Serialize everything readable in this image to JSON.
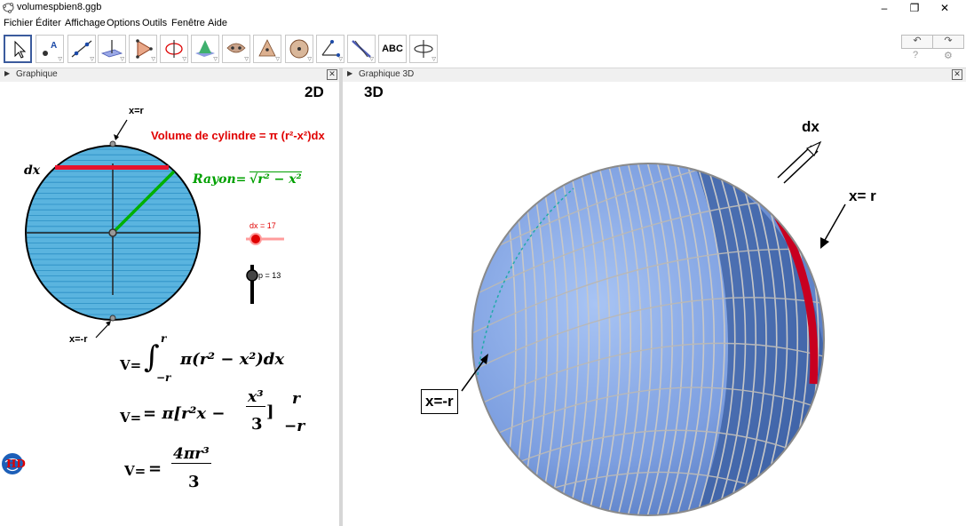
{
  "window": {
    "title": "volumespbien8.ggb",
    "minimize": "–",
    "maximize": "❐",
    "close": "✕"
  },
  "menu": [
    "Fichier",
    "Éditer",
    "Affichage",
    "Options",
    "Outils",
    "Fenêtre",
    "Aide"
  ],
  "toolbar": {
    "tools": [
      {
        "icon": "move-tool-icon"
      },
      {
        "icon": "point-tool-icon"
      },
      {
        "icon": "line-tool-icon"
      },
      {
        "icon": "perpendicular-tool-icon"
      },
      {
        "icon": "polygon-tool-icon"
      },
      {
        "icon": "circle-tool-icon"
      },
      {
        "icon": "intersect-surfaces-icon"
      },
      {
        "icon": "pyramid-tool-icon"
      },
      {
        "icon": "net-tool-icon"
      },
      {
        "icon": "sphere-tool-icon"
      },
      {
        "icon": "angle-tool-icon"
      },
      {
        "icon": "reflect-plane-icon"
      },
      {
        "icon": "text-tool-icon"
      },
      {
        "icon": "rotate-view-icon"
      }
    ],
    "text_tool_label": "ABC",
    "undo": "↶",
    "redo": "↷",
    "help_icon": "?",
    "settings_icon": "⚙"
  },
  "views": {
    "graphics": {
      "label": "Graphique",
      "corner_label": "2D"
    },
    "graphics3d": {
      "label": "Graphique 3D",
      "corner_label": "3D"
    }
  },
  "graphics2d": {
    "label_x_r": "x=r",
    "label_x_minus_r": "x=-r",
    "label_dx": "dx",
    "volume_title": "Volume de cylindre = π (r²-x²)dx",
    "rayon_label": "Rayon=",
    "rayon_expr": "√r² − x²",
    "slider_dx_label": "dx = 17",
    "slider_dx_value": 17,
    "slider_p_label": "p = 13",
    "slider_p_value": 13,
    "formula1_prefix": "V=",
    "formula1_upper": "r",
    "formula1_lower": "−r",
    "formula1_body": "π(r² − x²)dx",
    "formula2_prefix": "V=",
    "formula2_body": "= π[r²x −",
    "formula2_num": "x³",
    "formula2_den": "3",
    "formula2_close": "]",
    "formula2_upper": "r",
    "formula2_lower": "−r",
    "formula3_prefix": "V=",
    "formula3_eq": "=",
    "formula3_num": "4πr³",
    "formula3_den": "3",
    "colors": {
      "red": "#e00000",
      "green": "#00a000",
      "fill": "#5ab4df",
      "stripe": "#2a8ec4"
    }
  },
  "graphics3d_scene": {
    "label_dx": "dx",
    "label_x_r": "x= r",
    "label_x_minus_r": "x=-r",
    "colors": {
      "sphere_light": "#8db1ee",
      "sphere_dark": "#3a5ea0",
      "highlight": "#cc0000"
    }
  }
}
